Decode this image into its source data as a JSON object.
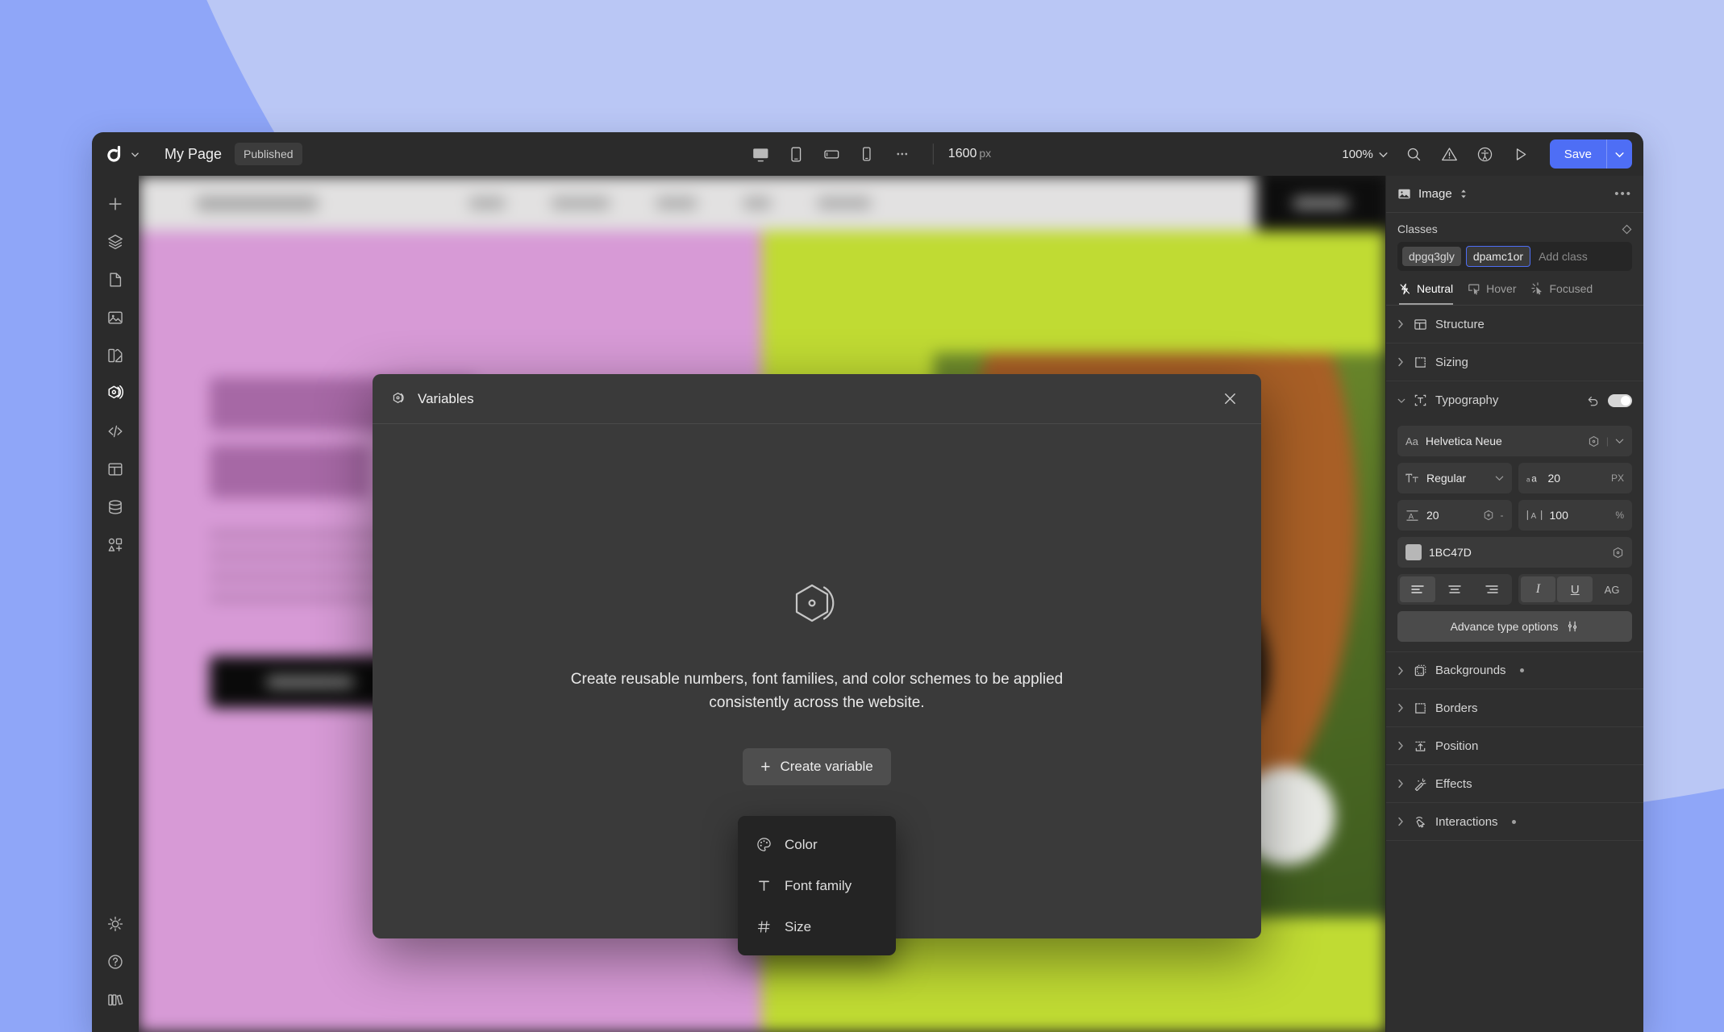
{
  "window": {
    "brand_icon": "d-logo-icon",
    "page_title": "My Page",
    "status_badge": "Published"
  },
  "toolbar": {
    "devices": [
      {
        "name": "desktop-view",
        "icon": "monitor-icon",
        "active": true
      },
      {
        "name": "tablet-view",
        "icon": "tablet-icon",
        "active": false
      },
      {
        "name": "tablet-landscape-view",
        "icon": "tablet-landscape-icon",
        "active": false
      },
      {
        "name": "mobile-view",
        "icon": "phone-icon",
        "active": false
      },
      {
        "name": "more-breakpoints",
        "icon": "ellipsis-icon",
        "active": false
      }
    ],
    "canvas_width": "1600",
    "canvas_width_unit": "px",
    "zoom_level": "100%",
    "actions": [
      {
        "name": "search",
        "icon": "search-icon"
      },
      {
        "name": "warnings",
        "icon": "warning-triangle-icon"
      },
      {
        "name": "accessibility",
        "icon": "accessibility-icon"
      },
      {
        "name": "preview",
        "icon": "play-icon"
      }
    ],
    "save_label": "Save",
    "save_color": "#4E6EF5"
  },
  "left_rail": {
    "top_items": [
      {
        "name": "add-element",
        "icon": "plus-icon",
        "selected": false
      },
      {
        "name": "layers",
        "icon": "layers-icon",
        "selected": false
      },
      {
        "name": "pages",
        "icon": "page-icon",
        "selected": false
      },
      {
        "name": "assets",
        "icon": "image-icon",
        "selected": false
      },
      {
        "name": "styles",
        "icon": "palette-icon",
        "selected": false
      },
      {
        "name": "variables",
        "icon": "hexagon-variable-icon",
        "selected": true
      },
      {
        "name": "code",
        "icon": "code-icon",
        "selected": false
      },
      {
        "name": "components",
        "icon": "layout-icon",
        "selected": false
      },
      {
        "name": "cms",
        "icon": "database-icon",
        "selected": false
      },
      {
        "name": "apps",
        "icon": "apps-icon",
        "selected": false
      }
    ],
    "bottom_items": [
      {
        "name": "theme-toggle",
        "icon": "sun-icon"
      },
      {
        "name": "help",
        "icon": "question-circle-icon"
      },
      {
        "name": "library",
        "icon": "books-icon"
      }
    ]
  },
  "canvas": {
    "site_nav_links": [
      "link-1",
      "link-2",
      "link-3",
      "link-4",
      "link-5"
    ],
    "colors": {
      "nav_bg": "#E2E1E1",
      "hero_left_bg": "#D79AD6",
      "hero_right_bg": "#C0DB33",
      "cta_bg": "#0D0D0D"
    }
  },
  "modal": {
    "icon": "hexagon-variable-icon",
    "title": "Variables",
    "close_icon": "close-icon",
    "empty_illustration": "hexagon-variable-icon",
    "empty_text": "Create reusable numbers, font families, and color schemes to be applied consistently across the website.",
    "create_button_label": "Create variable",
    "create_button_icon": "plus-icon",
    "menu_items": [
      {
        "label": "Color",
        "icon": "palette-icon"
      },
      {
        "label": "Font family",
        "icon": "text-t-icon"
      },
      {
        "label": "Size",
        "icon": "hash-icon"
      }
    ]
  },
  "right_panel": {
    "element_type": "Image",
    "element_icon": "image-icon",
    "overflow_icon": "ellipsis-icon",
    "classes_label": "Classes",
    "classes_expand_icon": "diamond-icon",
    "chips": [
      {
        "label": "dpgq3gly",
        "selected": false
      },
      {
        "label": "dpamc1or",
        "selected": true
      }
    ],
    "add_class_placeholder": "Add class",
    "state_tabs": [
      {
        "label": "Neutral",
        "icon": "lightning-off-icon",
        "active": true
      },
      {
        "label": "Hover",
        "icon": "cursor-box-icon",
        "active": false
      },
      {
        "label": "Focused",
        "icon": "cursor-sparkle-icon",
        "active": false
      }
    ],
    "sections": [
      {
        "label": "Structure",
        "icon": "structure-icon",
        "expanded": false,
        "has_dot": false
      },
      {
        "label": "Sizing",
        "icon": "sizing-icon",
        "expanded": false,
        "has_dot": false
      }
    ],
    "typography": {
      "label": "Typography",
      "icon": "typography-icon",
      "expanded": true,
      "reset_icon": "undo-icon",
      "toggle_on": true,
      "font_family_label": "Aa",
      "font_family": "Helvetica Neue",
      "font_variable_icon": "hexagon-icon",
      "font_dropdown_icon": "chevron-down-icon",
      "weight_icon": "weight-icon",
      "weight": "Regular",
      "size_icon": "font-size-icon",
      "size": "20",
      "size_unit": "PX",
      "line_height_icon": "line-height-icon",
      "line_height": "20",
      "line_height_variable_icon": "hexagon-icon",
      "line_height_unit": "-",
      "letter_spacing_icon": "letter-spacing-icon",
      "letter_spacing": "100",
      "letter_spacing_unit": "%",
      "color_hex": "1BC47D",
      "color_swatch": "#B7B7B7",
      "color_variable_icon": "hexagon-icon",
      "align_buttons": [
        {
          "name": "align-left",
          "active": true
        },
        {
          "name": "align-center",
          "active": false
        },
        {
          "name": "align-right",
          "active": false
        }
      ],
      "style_buttons": [
        {
          "name": "italic",
          "label": "I",
          "active": true
        },
        {
          "name": "underline",
          "label": "U",
          "active": true
        },
        {
          "name": "text-transform",
          "label": "AG",
          "active": false
        }
      ],
      "advanced_label": "Advance type options",
      "advanced_icon": "sliders-icon"
    },
    "sections_bottom": [
      {
        "label": "Backgrounds",
        "icon": "backgrounds-icon",
        "expanded": false,
        "has_dot": true
      },
      {
        "label": "Borders",
        "icon": "borders-icon",
        "expanded": false,
        "has_dot": false
      },
      {
        "label": "Position",
        "icon": "position-icon",
        "expanded": false,
        "has_dot": false
      },
      {
        "label": "Effects",
        "icon": "effects-wand-icon",
        "expanded": false,
        "has_dot": false
      },
      {
        "label": "Interactions",
        "icon": "interactions-icon",
        "expanded": false,
        "has_dot": true
      }
    ]
  },
  "desktop": {
    "bg_color": "#8FA6F8",
    "arc_color": "#BAC7F5"
  }
}
